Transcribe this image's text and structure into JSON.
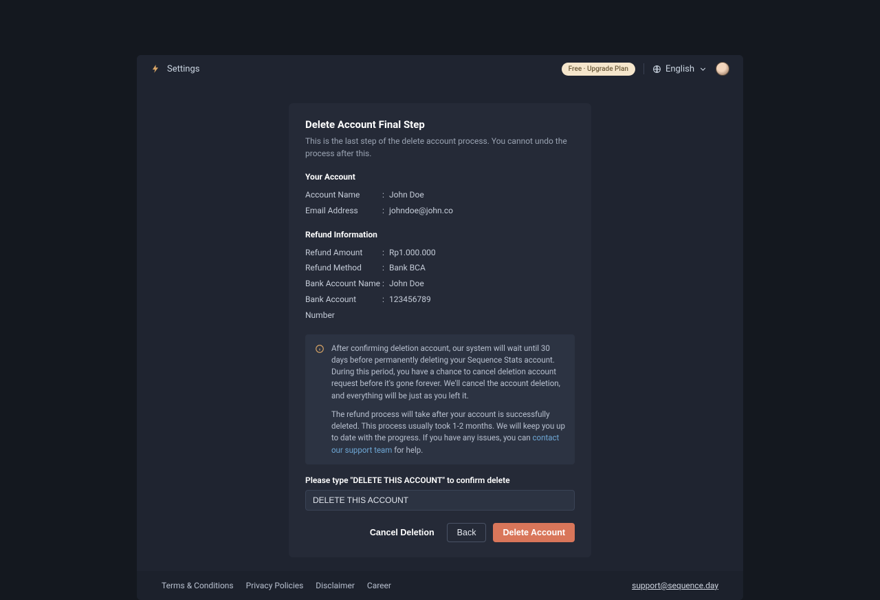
{
  "header": {
    "page_title": "Settings",
    "upgrade_pill": "Free · Upgrade Plan",
    "language": "English"
  },
  "card": {
    "title": "Delete Account Final Step",
    "subtitle": "This is the last step of the delete account process. You cannot undo the process after this.",
    "account_section": "Your Account",
    "account": {
      "name_label": "Account Name",
      "name_value": "John Doe",
      "email_label": "Email Address",
      "email_value": "johndoe@john.co"
    },
    "refund_section": "Refund Information",
    "refund": {
      "amount_label": "Refund Amount",
      "amount_value": "Rp1.000.000",
      "method_label": "Refund Method",
      "method_value": "Bank BCA",
      "bank_name_label": "Bank Account Name",
      "bank_name_value": "John Doe",
      "bank_num_label": "Bank Account Number",
      "bank_num_value": "123456789"
    },
    "info": {
      "p1": "After confirming deletion account, our system will wait until 30 days before permanently deleting your Sequence Stats account. During this period, you have a chance to cancel deletion account request before it's gone forever. We'll cancel the account deletion, and everything will be just as you left it.",
      "p2a": "The refund process will take after your account is successfully deleted. This process usually took 1-2 months. We will keep you up to date with the progress. If you have any issues, you can ",
      "p2_link": "contact our support team",
      "p2b": " for help."
    },
    "confirm_label": "Please type \"DELETE THIS ACCOUNT\" to confirm delete",
    "confirm_value": "DELETE THIS ACCOUNT",
    "actions": {
      "cancel": "Cancel Deletion",
      "back": "Back",
      "delete": "Delete Account"
    }
  },
  "footer": {
    "terms": "Terms & Conditions",
    "privacy": "Privacy Policies",
    "disclaimer": "Disclaimer",
    "career": "Career",
    "support": "support@sequence.day"
  }
}
